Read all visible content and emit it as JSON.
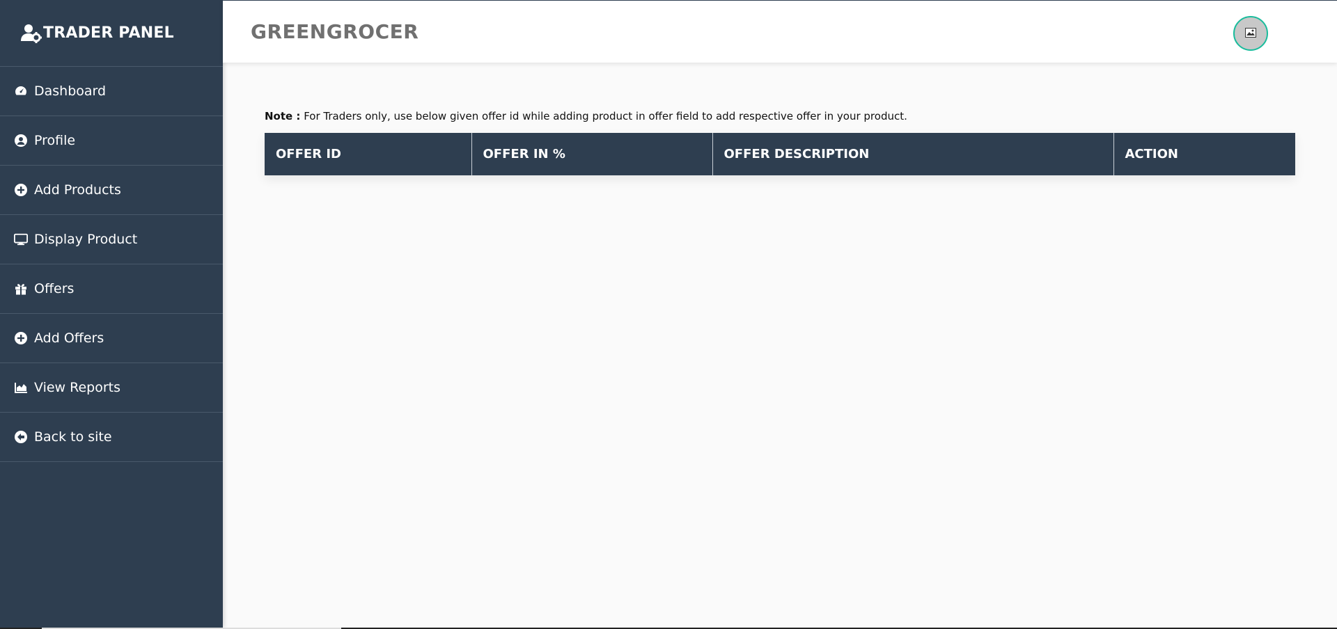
{
  "sidebar": {
    "brand": "TRADER PANEL",
    "brand_icon": "user-gear-icon",
    "items": [
      {
        "label": "Dashboard",
        "icon": "gauge-icon"
      },
      {
        "label": "Profile",
        "icon": "user-circle-icon"
      },
      {
        "label": "Add Products",
        "icon": "plus-circle-icon"
      },
      {
        "label": "Display Product",
        "icon": "desktop-icon"
      },
      {
        "label": "Offers",
        "icon": "gift-icon"
      },
      {
        "label": "Add Offers",
        "icon": "plus-circle-icon"
      },
      {
        "label": "View Reports",
        "icon": "area-chart-icon"
      },
      {
        "label": "Back to site",
        "icon": "arrow-circle-left-icon"
      }
    ]
  },
  "header": {
    "title": "GREENGROCER",
    "avatar_icon": "image-icon",
    "avatar_border_color": "#1abc9c"
  },
  "main": {
    "note_label": "Note :",
    "note_text": " For Traders only, use below given offer id while adding product in offer field to add respective offer in your product.",
    "table": {
      "columns": [
        "OFFER ID",
        "OFFER IN %",
        "OFFER DESCRIPTION",
        "ACTION"
      ],
      "rows": []
    }
  },
  "colors": {
    "sidebar_bg": "#2e3e50",
    "table_header_bg": "#2e3e50",
    "title_gray": "#707070"
  }
}
